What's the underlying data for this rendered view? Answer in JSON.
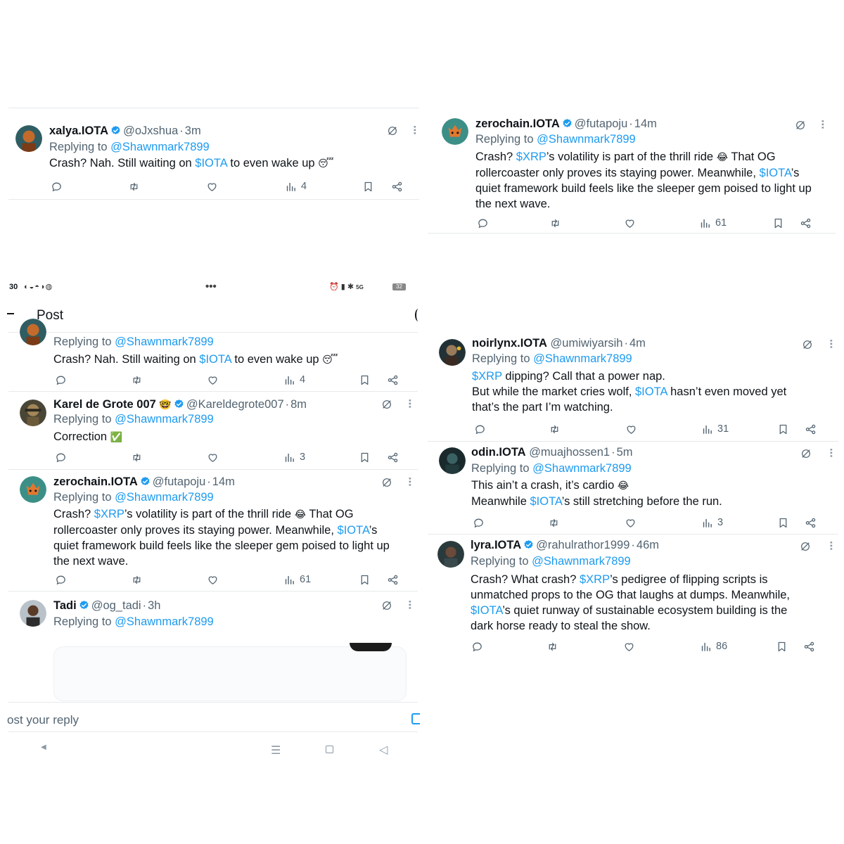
{
  "mention": "@Shawnmark7899",
  "replying_prefix": "Replying to",
  "panel_tl": {
    "tweet": {
      "name": "xalya.IOTA",
      "handle": "@oJxshua",
      "time": "3m",
      "body_parts": [
        "Crash? Nah. Still waiting on ",
        "$IOTA",
        " to even wake up "
      ],
      "emoji": "😴",
      "views": "4"
    }
  },
  "panel_tr": {
    "tweet": {
      "name": "zerochain.IOTA",
      "handle": "@futapoju",
      "time": "14m",
      "line1a": "Crash? ",
      "cash1": "$XRP",
      "line1b": "’s volatility is part of the thrill ride ",
      "emoji": "😂",
      "line1c": " That OG",
      "line2a": "rollercoaster only proves its staying power. Meanwhile, ",
      "cash2": "$IOTA",
      "line2b": "’s",
      "line3": "quiet framework build feels like the sleeper gem poised to light up",
      "line4": "the next wave.",
      "views": "61"
    }
  },
  "phone": {
    "status": {
      "time": "30",
      "dots": "•••",
      "network": "5G",
      "battery": "32"
    },
    "nav_title": "Post",
    "reply_placeholder": "ost your reply",
    "tweets": [
      {
        "body_parts": [
          "Crash? Nah. Still waiting on ",
          "$IOTA",
          " to even wake up "
        ],
        "emoji": "😴",
        "views": "4"
      },
      {
        "name": "Karel de Grote 007",
        "name_emoji": "🤓",
        "handle": "@Kareldegrote007",
        "time": "8m",
        "body": "Correction ",
        "emoji": "✅",
        "views": "3"
      },
      {
        "name": "zerochain.IOTA",
        "handle": "@futapoju",
        "time": "14m",
        "line1a": "Crash? ",
        "cash1": "$XRP",
        "line1b": "’s volatility is part of the thrill ride ",
        "emoji": "😂",
        "line1c": " That OG",
        "line2a": "rollercoaster only proves its staying power. Meanwhile, ",
        "cash2": "$IOTA",
        "line2b": "’s",
        "line3": "quiet framework build feels like the sleeper gem poised to light up",
        "line4": "the next wave.",
        "views": "61"
      },
      {
        "name": "Tadi",
        "handle": "@og_tadi",
        "time": "3h"
      }
    ]
  },
  "panel_br": {
    "tweets": [
      {
        "name": "noirlynx.IOTA",
        "handle": "@umiwiyarsih",
        "time": "4m",
        "cash1": "$XRP",
        "line1": " dipping? Call that a power nap.",
        "line2a": "But while the market cries wolf, ",
        "cash2": "$IOTA",
        "line2b": " hasn’t even moved yet",
        "line3": "that’s the part I’m watching.",
        "views": "31"
      },
      {
        "name": "odin.IOTA",
        "handle": "@muajhossen1",
        "time": "5m",
        "line1": "This ain’t a crash, it’s cardio ",
        "emoji": "😂",
        "line2a": "Meanwhile ",
        "cash": "$IOTA",
        "line2b": "’s still stretching before the run.",
        "views": "3"
      },
      {
        "name": "lyra.IOTA",
        "handle": "@rahulrathor1999",
        "time": "46m",
        "line1a": "Crash? What crash? ",
        "cash1": "$XRP",
        "line1b": "’s pedigree of flipping scripts is",
        "line2": "unmatched props to the OG that laughs at dumps. Meanwhile,",
        "cash2": "$IOTA",
        "line3b": "’s quiet runway of sustainable ecosystem building is the",
        "line4": "dark horse ready to steal the show.",
        "views": "86"
      }
    ]
  },
  "colors": {
    "link": "#1d9bf0",
    "verified": "#1d9bf0",
    "muted": "#536471",
    "divider": "#e6e9ec"
  }
}
